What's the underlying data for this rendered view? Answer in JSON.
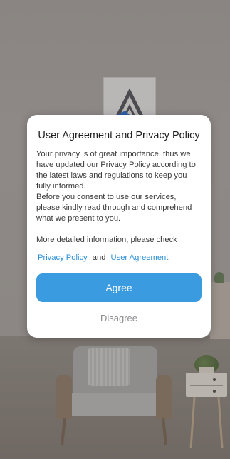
{
  "dialog": {
    "title": "User Agreement and Privacy Policy",
    "body_paragraph_1": "Your privacy is of great importance, thus we have updated our Privacy Policy according to the latest laws and regulations to keep you fully informed.",
    "body_paragraph_2": "Before you consent to use our services, please kindly read through and comprehend what we present to you.",
    "more_info": "More detailed information, please check",
    "privacy_policy_link": "Privacy Policy",
    "links_conjunction": "and",
    "user_agreement_link": "User Agreement",
    "agree_label": "Agree",
    "disagree_label": "Disagree"
  },
  "colors": {
    "accent": "#3a9be0",
    "link": "#2a8fd8",
    "overlay": "#6b6866"
  },
  "icons": {
    "background_logo": "app-logo-icon"
  }
}
